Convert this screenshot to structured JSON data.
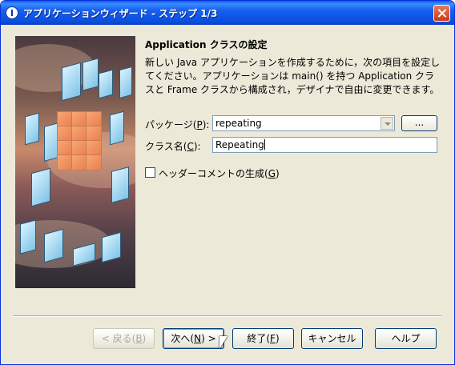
{
  "window": {
    "title": "アプリケーションウィザード - ステップ 1/3"
  },
  "content": {
    "heading": "Application クラスの設定",
    "description": "新しい Java アプリケーションを作成するために，次の項目を設定してください。アプリケーションは main() を持つ Application クラスと Frame クラスから構成され，デザイナで自由に変更できます。"
  },
  "form": {
    "package_label": "パッケージ",
    "package_mnemonic": "P",
    "package_value": "repeating",
    "browse_label": "...",
    "class_label": "クラス名",
    "class_mnemonic": "C",
    "class_value": "Repeating",
    "header_comment_label": "ヘッダーコメントの生成",
    "header_comment_mnemonic": "G",
    "header_comment_checked": false
  },
  "buttons": {
    "back": {
      "label": "< 戻る",
      "mnemonic": "B"
    },
    "next": {
      "label": "次へ",
      "mnemonic": "N",
      "suffix": " >"
    },
    "finish": {
      "label": "終了",
      "mnemonic": "F"
    },
    "cancel": {
      "label": "キャンセル"
    },
    "help": {
      "label": "ヘルプ"
    }
  },
  "icons": {
    "title": "java-app-icon",
    "close": "close-icon"
  }
}
